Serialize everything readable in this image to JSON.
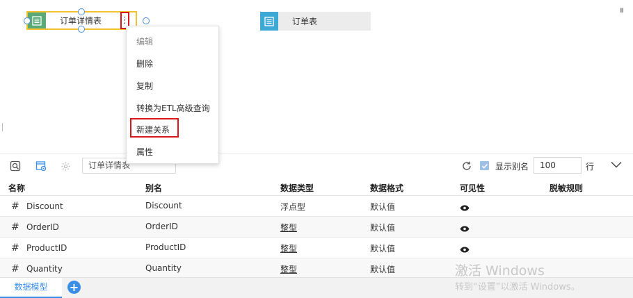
{
  "canvas": {
    "node_detail": {
      "label": "订单详情表",
      "icon": "table-icon",
      "color": "#5aaa78",
      "border": "#f2c230"
    },
    "node_order": {
      "label": "订单表",
      "icon": "table-icon",
      "color": "#3fa9d6"
    },
    "kebab_glyph": "⋮",
    "panel_toggle_glyph": "III"
  },
  "context_menu": {
    "items": [
      {
        "label": "编辑",
        "disabled": true
      },
      {
        "label": "删除",
        "disabled": false
      },
      {
        "label": "复制",
        "disabled": false
      },
      {
        "label": "转换为ETL高级查询",
        "disabled": false
      },
      {
        "label": "新建关系",
        "disabled": false,
        "highlighted": true
      },
      {
        "label": "属性",
        "disabled": false
      }
    ],
    "highlight_color": "#d9161c"
  },
  "toolbar": {
    "table_select_value": "订单详情表",
    "show_alias_label": "显示别名",
    "show_alias_checked": true,
    "row_count_value": "100",
    "row_unit": "行"
  },
  "table": {
    "columns": [
      "名称",
      "别名",
      "数据类型",
      "数据格式",
      "可见性",
      "脱敏规则"
    ],
    "rows": [
      {
        "name": "Discount",
        "alias": "Discount",
        "type": "浮点型",
        "format": "默认值",
        "visible": true,
        "mask": ""
      },
      {
        "name": "OrderID",
        "alias": "OrderID",
        "type": "整型",
        "format": "默认值",
        "visible": true,
        "mask": ""
      },
      {
        "name": "ProductID",
        "alias": "ProductID",
        "type": "整型",
        "format": "默认值",
        "visible": true,
        "mask": ""
      },
      {
        "name": "Quantity",
        "alias": "Quantity",
        "type": "整型",
        "format": "默认值",
        "visible": true,
        "mask": ""
      }
    ],
    "field_type_glyph": "#"
  },
  "watermark": {
    "line1": "激活 Windows",
    "line2": "转到“设置”以激活 Windows。"
  },
  "bottom_tabs": {
    "active_tab": "数据模型",
    "add_glyph": "+",
    "accent": "#3a8ee6"
  }
}
